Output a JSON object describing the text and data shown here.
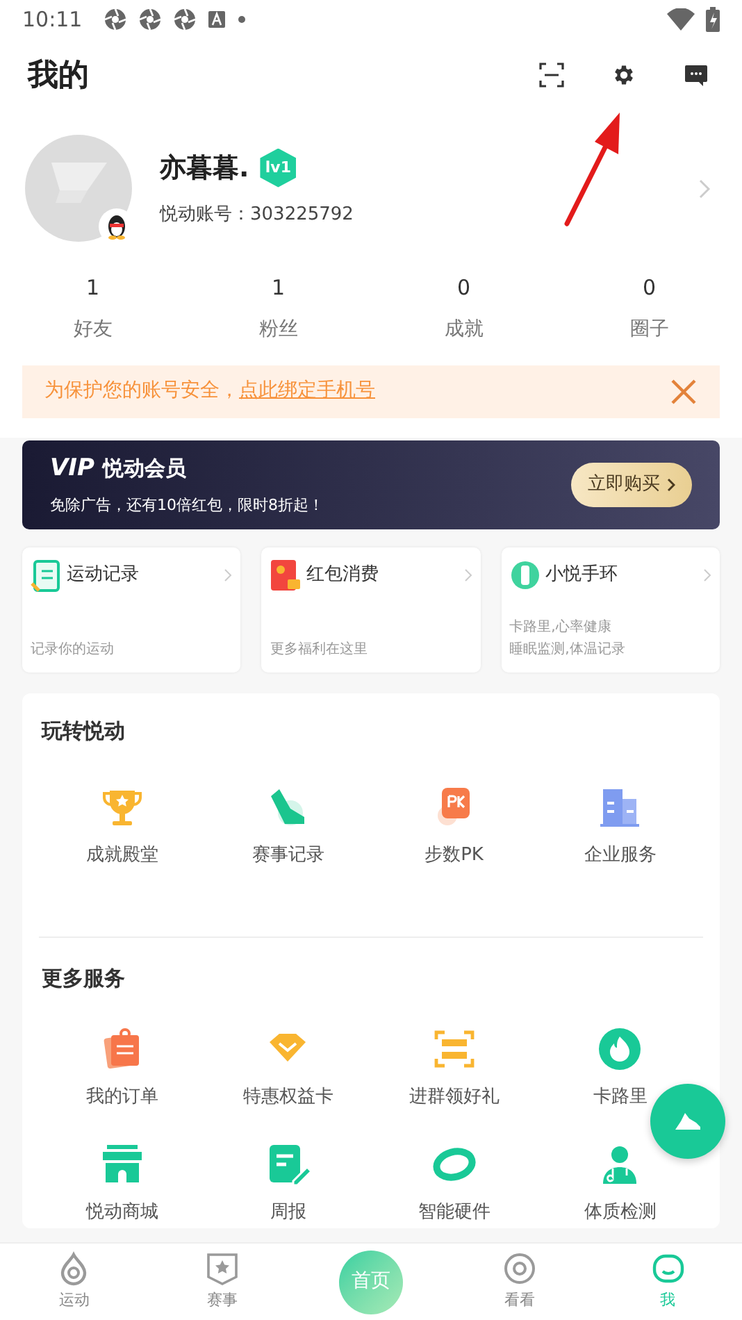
{
  "status_bar": {
    "time": "10:11",
    "notification_icons": [
      {
        "kind": "app"
      },
      {
        "kind": "app"
      },
      {
        "kind": "app"
      },
      {
        "kind": "keyboard"
      },
      {
        "kind": "dot"
      }
    ]
  },
  "header": {
    "title": "我的"
  },
  "profile": {
    "name": "亦暮暮.",
    "level": "lv1",
    "account_label": "悦动账号：",
    "account_id": "303225792"
  },
  "stats": [
    {
      "value": "1",
      "label": "好友"
    },
    {
      "value": "1",
      "label": "粉丝"
    },
    {
      "value": "0",
      "label": "成就"
    },
    {
      "value": "0",
      "label": "圈子"
    }
  ],
  "notice": {
    "text": "为保护您的账号安全，",
    "link": "点此绑定手机号"
  },
  "vip": {
    "badge": "VIP",
    "title": "悦动会员",
    "subtitle": "免除广告，还有10倍红包，限时8折起！",
    "button": "立即购买"
  },
  "quick_cards": [
    {
      "kind": "record",
      "title": "运动记录",
      "lines": [
        "记录你的运动"
      ]
    },
    {
      "kind": "redpacket",
      "title": "红包消费",
      "lines": [
        "更多福利在这里"
      ]
    },
    {
      "kind": "band",
      "title": "小悦手环",
      "lines": [
        "卡路里,心率健康",
        "睡眠监测,体温记录"
      ]
    }
  ],
  "sections": [
    {
      "title": "玩转悦动",
      "items": [
        {
          "kind": "trophy",
          "label": "成就殿堂"
        },
        {
          "kind": "shoe",
          "label": "赛事记录"
        },
        {
          "kind": "pk",
          "label": "步数PK"
        },
        {
          "kind": "building",
          "label": "企业服务"
        }
      ]
    },
    {
      "title": "更多服务",
      "items": [
        {
          "kind": "order",
          "label": "我的订单"
        },
        {
          "kind": "diamond",
          "label": "特惠权益卡"
        },
        {
          "kind": "scan",
          "label": "进群领好礼"
        },
        {
          "kind": "flame",
          "label": "卡路里"
        },
        {
          "kind": "shop",
          "label": "悦动商城"
        },
        {
          "kind": "note",
          "label": "周报"
        },
        {
          "kind": "ring",
          "label": "智能硬件"
        },
        {
          "kind": "doctor",
          "label": "体质检测"
        }
      ]
    }
  ],
  "bottom_nav": [
    {
      "kind": "drop",
      "label": "运动",
      "selected": false
    },
    {
      "kind": "shield",
      "label": "赛事",
      "selected": false
    },
    {
      "kind": "home",
      "label": "首页",
      "selected": false
    },
    {
      "kind": "eye",
      "label": "看看",
      "selected": false
    },
    {
      "kind": "face",
      "label": "我",
      "selected": true
    }
  ]
}
